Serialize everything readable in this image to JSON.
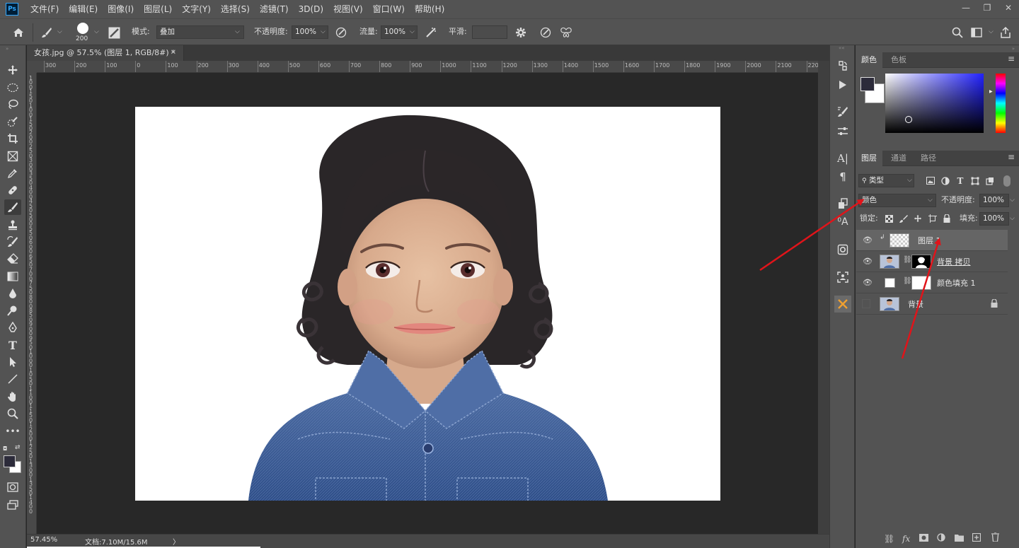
{
  "app": {
    "logo": "Ps"
  },
  "menu": [
    "文件(F)",
    "编辑(E)",
    "图像(I)",
    "图层(L)",
    "文字(Y)",
    "选择(S)",
    "滤镜(T)",
    "3D(D)",
    "视图(V)",
    "窗口(W)",
    "帮助(H)"
  ],
  "window_controls": {
    "minimize": "—",
    "restore": "❐",
    "close": "✕"
  },
  "options": {
    "brush_size": "200",
    "mode_label": "模式:",
    "mode_value": "叠加",
    "opacity_label": "不透明度:",
    "opacity_value": "100%",
    "flow_label": "流量:",
    "flow_value": "100%",
    "smoothing_label": "平滑:",
    "smoothing_value": ""
  },
  "document": {
    "tab_title": "女孩.jpg @ 57.5% (图层 1, RGB/8#) *",
    "close": "✕"
  },
  "ruler": {
    "horizontal": [
      "300",
      "200",
      "100",
      "0",
      "100",
      "200",
      "300",
      "400",
      "500",
      "600",
      "700",
      "800",
      "900",
      "1000",
      "1100",
      "1200",
      "1300",
      "1400",
      "1500",
      "1600",
      "1700",
      "1800",
      "1900",
      "2000",
      "2100",
      "2200"
    ],
    "vertical": [
      "1",
      "0",
      "0",
      "1",
      "5",
      "0",
      "1",
      "0",
      "0",
      "1",
      "5",
      "0",
      "2",
      "0",
      "0",
      "2",
      "5",
      "0",
      "3",
      "0",
      "0",
      "3",
      "5",
      "0",
      "4",
      "0",
      "0",
      "4",
      "5",
      "0",
      "5",
      "0",
      "0",
      "5",
      "5",
      "0",
      "6",
      "0",
      "0",
      "6",
      "5",
      "0",
      "7",
      "0",
      "0",
      "7",
      "5",
      "0",
      "8",
      "0",
      "0",
      "8",
      "5",
      "0",
      "9",
      "0",
      "0",
      "9",
      "5",
      "0",
      "1",
      "0",
      "0",
      "0",
      "1",
      "0",
      "5",
      "0",
      "1",
      "1",
      "0",
      "0",
      "1",
      "1",
      "5",
      "0",
      "1",
      "2",
      "0",
      "0",
      "1",
      "2",
      "5",
      "0",
      "1",
      "3",
      "0",
      "0",
      "1",
      "3",
      "5",
      "0",
      "1",
      "4",
      "0",
      "0"
    ]
  },
  "status": {
    "zoom": "57.45%",
    "doc_size": "文档:7.10M/15.6M",
    "arrow": "〉"
  },
  "color_panel": {
    "tabs": [
      "颜色",
      "色板"
    ],
    "menu": "≡"
  },
  "layers_panel": {
    "tabs": [
      "图层",
      "通道",
      "路径"
    ],
    "menu": "≡",
    "filter_kind": "类型",
    "blend_mode": "颜色",
    "opacity_label": "不透明度:",
    "opacity_value": "100%",
    "lock_label": "锁定:",
    "fill_label": "填充:",
    "fill_value": "100%",
    "layers": [
      {
        "name": "图层 1",
        "visible": true,
        "selected": true,
        "clipped": true
      },
      {
        "name": "背景 拷贝",
        "visible": true,
        "selected": false,
        "mask": true
      },
      {
        "name": "颜色填充 1",
        "visible": true,
        "selected": false,
        "mask": true
      },
      {
        "name": "背景",
        "visible": false,
        "selected": false,
        "locked": true
      }
    ]
  },
  "colors": {
    "ui_bg": "#535353",
    "canvas_bg": "#282828",
    "accent": "#31a8ff",
    "annotation_arrow": "#e0141a",
    "selected_layer": "#656565"
  }
}
